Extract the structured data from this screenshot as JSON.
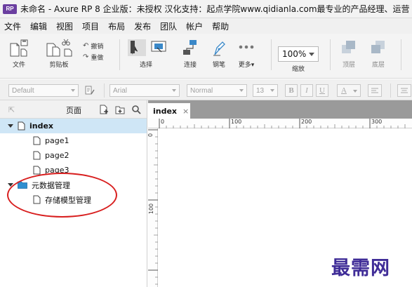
{
  "window": {
    "title": "未命名 - Axure RP 8 企业版：未授权 汉化支持：起点学院www.qidianla.com最专业的产品经理、运营",
    "logo_text": "RP"
  },
  "menu": [
    "文件",
    "编辑",
    "视图",
    "项目",
    "布局",
    "发布",
    "团队",
    "帐户",
    "帮助"
  ],
  "toolbar": {
    "file_label": "文件",
    "clipboard_label": "剪贴板",
    "cut_label": "撤销",
    "redo_label": "重做",
    "select_label": "选择",
    "connect_label": "连接",
    "pen_label": "钢笔",
    "more_label": "更多▾",
    "zoom_value": "100%",
    "zoom_label": "缩放",
    "top_label": "顶层",
    "bottom_label": "底层"
  },
  "stylebar": {
    "style_value": "Default",
    "font_value": "Arial",
    "weight_value": "Normal",
    "size_value": "13",
    "bold_label": "B",
    "italic_label": "I",
    "underline_label": "U",
    "color_label": "A"
  },
  "pages_panel": {
    "title": "页面",
    "tree": [
      {
        "label": "index",
        "level": 0
      },
      {
        "label": "page1",
        "level": 1
      },
      {
        "label": "page2",
        "level": 1
      },
      {
        "label": "page3",
        "level": 1
      },
      {
        "label": "元数据管理",
        "level": 0
      },
      {
        "label": "存储模型管理",
        "level": 1
      }
    ]
  },
  "canvas": {
    "tab_label": "index",
    "tab_close": "×",
    "ruler_h": [
      "0",
      "100",
      "200",
      "300"
    ],
    "ruler_v": [
      "0",
      "100"
    ]
  },
  "watermark": "最需网",
  "colors": {
    "selected_row": "#cfe6f6",
    "annotation": "#d81e1e",
    "watermark": "#3f2c97",
    "logo": "#6b3fa0"
  }
}
